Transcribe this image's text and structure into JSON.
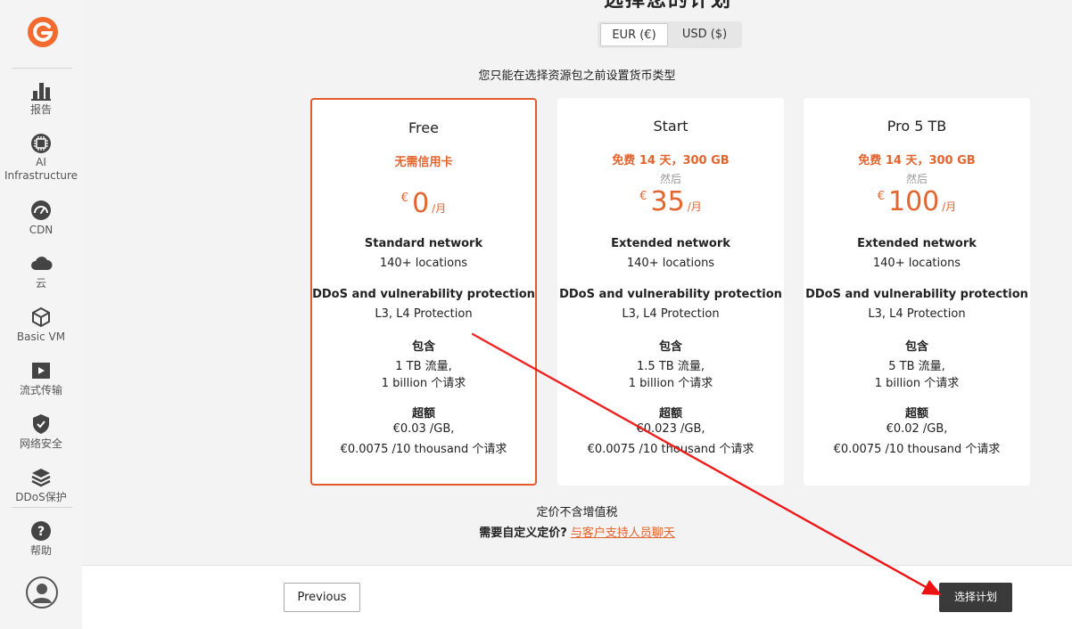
{
  "sidebar": {
    "items": [
      {
        "label": "报告",
        "icon": "bar-chart-icon"
      },
      {
        "label": "AI Infrastructure",
        "icon": "chip-icon"
      },
      {
        "label": "CDN",
        "icon": "speedometer-icon"
      },
      {
        "label": "云",
        "icon": "cloud-icon"
      },
      {
        "label": "Basic VM",
        "icon": "cube-icon"
      },
      {
        "label": "流式传输",
        "icon": "play-icon"
      },
      {
        "label": "网络安全",
        "icon": "shield-check-icon"
      },
      {
        "label": "DDoS保护",
        "icon": "layers-icon"
      },
      {
        "label": "帮助",
        "icon": "help-icon"
      }
    ],
    "ai_label_line1": "AI",
    "ai_label_line2": "Infrastructure"
  },
  "header": {
    "title_partial": "选择您的计划"
  },
  "currency": {
    "options": [
      "EUR (€)",
      "USD ($)"
    ],
    "selected": "EUR (€)",
    "note": "您只能在选择资源包之前设置货币类型"
  },
  "plans": [
    {
      "name": "Free",
      "offer": "无需信用卡",
      "then": "",
      "currency_symbol": "€",
      "price": "0",
      "per": "/月",
      "network": "Standard network",
      "locations": "140+ locations",
      "protection": "DDoS and vulnerability protection",
      "protection_detail": "L3, L4 Protection",
      "includes_label": "包含",
      "traffic": "1 TB 流量,",
      "requests": "1 billion 个请求",
      "overage_label": "超额",
      "overage_traffic": "€0.03 /GB,",
      "overage_requests": "€0.0075 /10 thousand 个请求"
    },
    {
      "name": "Start",
      "offer": "免费 14 天，300 GB",
      "then": "然后",
      "currency_symbol": "€",
      "price": "35",
      "per": "/月",
      "network": "Extended network",
      "locations": "140+ locations",
      "protection": "DDoS and vulnerability protection",
      "protection_detail": "L3, L4 Protection",
      "includes_label": "包含",
      "traffic": "1.5 TB 流量,",
      "requests": "1 billion 个请求",
      "overage_label": "超额",
      "overage_traffic": "€0.023 /GB,",
      "overage_requests": "€0.0075 /10 thousand 个请求"
    },
    {
      "name": "Pro 5 TB",
      "offer": "免费 14 天，300 GB",
      "then": "然后",
      "currency_symbol": "€",
      "price": "100",
      "per": "/月",
      "network": "Extended network",
      "locations": "140+ locations",
      "protection": "DDoS and vulnerability protection",
      "protection_detail": "L3, L4 Protection",
      "includes_label": "包含",
      "traffic": "5 TB 流量,",
      "requests": "1 billion 个请求",
      "overage_label": "超额",
      "overage_traffic": "€0.02 /GB,",
      "overage_requests": "€0.0075 /10 thousand 个请求"
    }
  ],
  "vat_note": "定价不含增值税",
  "custom_pricing": {
    "question": "需要自定义定价?",
    "link": "与客户支持人员聊天"
  },
  "footer": {
    "previous": "Previous",
    "select_plan": "选择计划"
  },
  "colors": {
    "accent": "#e4642e",
    "selected_border": "#e45b2b",
    "dark_button": "#3a3a3a",
    "annotation_arrow": "#ee1111"
  }
}
